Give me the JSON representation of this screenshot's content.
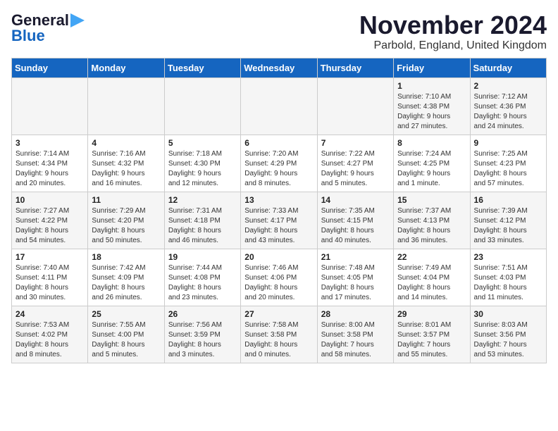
{
  "header": {
    "logo_line1": "General",
    "logo_line2": "Blue",
    "month": "November 2024",
    "location": "Parbold, England, United Kingdom"
  },
  "weekdays": [
    "Sunday",
    "Monday",
    "Tuesday",
    "Wednesday",
    "Thursday",
    "Friday",
    "Saturday"
  ],
  "weeks": [
    [
      {
        "day": "",
        "info": ""
      },
      {
        "day": "",
        "info": ""
      },
      {
        "day": "",
        "info": ""
      },
      {
        "day": "",
        "info": ""
      },
      {
        "day": "",
        "info": ""
      },
      {
        "day": "1",
        "info": "Sunrise: 7:10 AM\nSunset: 4:38 PM\nDaylight: 9 hours\nand 27 minutes."
      },
      {
        "day": "2",
        "info": "Sunrise: 7:12 AM\nSunset: 4:36 PM\nDaylight: 9 hours\nand 24 minutes."
      }
    ],
    [
      {
        "day": "3",
        "info": "Sunrise: 7:14 AM\nSunset: 4:34 PM\nDaylight: 9 hours\nand 20 minutes."
      },
      {
        "day": "4",
        "info": "Sunrise: 7:16 AM\nSunset: 4:32 PM\nDaylight: 9 hours\nand 16 minutes."
      },
      {
        "day": "5",
        "info": "Sunrise: 7:18 AM\nSunset: 4:30 PM\nDaylight: 9 hours\nand 12 minutes."
      },
      {
        "day": "6",
        "info": "Sunrise: 7:20 AM\nSunset: 4:29 PM\nDaylight: 9 hours\nand 8 minutes."
      },
      {
        "day": "7",
        "info": "Sunrise: 7:22 AM\nSunset: 4:27 PM\nDaylight: 9 hours\nand 5 minutes."
      },
      {
        "day": "8",
        "info": "Sunrise: 7:24 AM\nSunset: 4:25 PM\nDaylight: 9 hours\nand 1 minute."
      },
      {
        "day": "9",
        "info": "Sunrise: 7:25 AM\nSunset: 4:23 PM\nDaylight: 8 hours\nand 57 minutes."
      }
    ],
    [
      {
        "day": "10",
        "info": "Sunrise: 7:27 AM\nSunset: 4:22 PM\nDaylight: 8 hours\nand 54 minutes."
      },
      {
        "day": "11",
        "info": "Sunrise: 7:29 AM\nSunset: 4:20 PM\nDaylight: 8 hours\nand 50 minutes."
      },
      {
        "day": "12",
        "info": "Sunrise: 7:31 AM\nSunset: 4:18 PM\nDaylight: 8 hours\nand 46 minutes."
      },
      {
        "day": "13",
        "info": "Sunrise: 7:33 AM\nSunset: 4:17 PM\nDaylight: 8 hours\nand 43 minutes."
      },
      {
        "day": "14",
        "info": "Sunrise: 7:35 AM\nSunset: 4:15 PM\nDaylight: 8 hours\nand 40 minutes."
      },
      {
        "day": "15",
        "info": "Sunrise: 7:37 AM\nSunset: 4:13 PM\nDaylight: 8 hours\nand 36 minutes."
      },
      {
        "day": "16",
        "info": "Sunrise: 7:39 AM\nSunset: 4:12 PM\nDaylight: 8 hours\nand 33 minutes."
      }
    ],
    [
      {
        "day": "17",
        "info": "Sunrise: 7:40 AM\nSunset: 4:11 PM\nDaylight: 8 hours\nand 30 minutes."
      },
      {
        "day": "18",
        "info": "Sunrise: 7:42 AM\nSunset: 4:09 PM\nDaylight: 8 hours\nand 26 minutes."
      },
      {
        "day": "19",
        "info": "Sunrise: 7:44 AM\nSunset: 4:08 PM\nDaylight: 8 hours\nand 23 minutes."
      },
      {
        "day": "20",
        "info": "Sunrise: 7:46 AM\nSunset: 4:06 PM\nDaylight: 8 hours\nand 20 minutes."
      },
      {
        "day": "21",
        "info": "Sunrise: 7:48 AM\nSunset: 4:05 PM\nDaylight: 8 hours\nand 17 minutes."
      },
      {
        "day": "22",
        "info": "Sunrise: 7:49 AM\nSunset: 4:04 PM\nDaylight: 8 hours\nand 14 minutes."
      },
      {
        "day": "23",
        "info": "Sunrise: 7:51 AM\nSunset: 4:03 PM\nDaylight: 8 hours\nand 11 minutes."
      }
    ],
    [
      {
        "day": "24",
        "info": "Sunrise: 7:53 AM\nSunset: 4:02 PM\nDaylight: 8 hours\nand 8 minutes."
      },
      {
        "day": "25",
        "info": "Sunrise: 7:55 AM\nSunset: 4:00 PM\nDaylight: 8 hours\nand 5 minutes."
      },
      {
        "day": "26",
        "info": "Sunrise: 7:56 AM\nSunset: 3:59 PM\nDaylight: 8 hours\nand 3 minutes."
      },
      {
        "day": "27",
        "info": "Sunrise: 7:58 AM\nSunset: 3:58 PM\nDaylight: 8 hours\nand 0 minutes."
      },
      {
        "day": "28",
        "info": "Sunrise: 8:00 AM\nSunset: 3:58 PM\nDaylight: 7 hours\nand 58 minutes."
      },
      {
        "day": "29",
        "info": "Sunrise: 8:01 AM\nSunset: 3:57 PM\nDaylight: 7 hours\nand 55 minutes."
      },
      {
        "day": "30",
        "info": "Sunrise: 8:03 AM\nSunset: 3:56 PM\nDaylight: 7 hours\nand 53 minutes."
      }
    ]
  ]
}
